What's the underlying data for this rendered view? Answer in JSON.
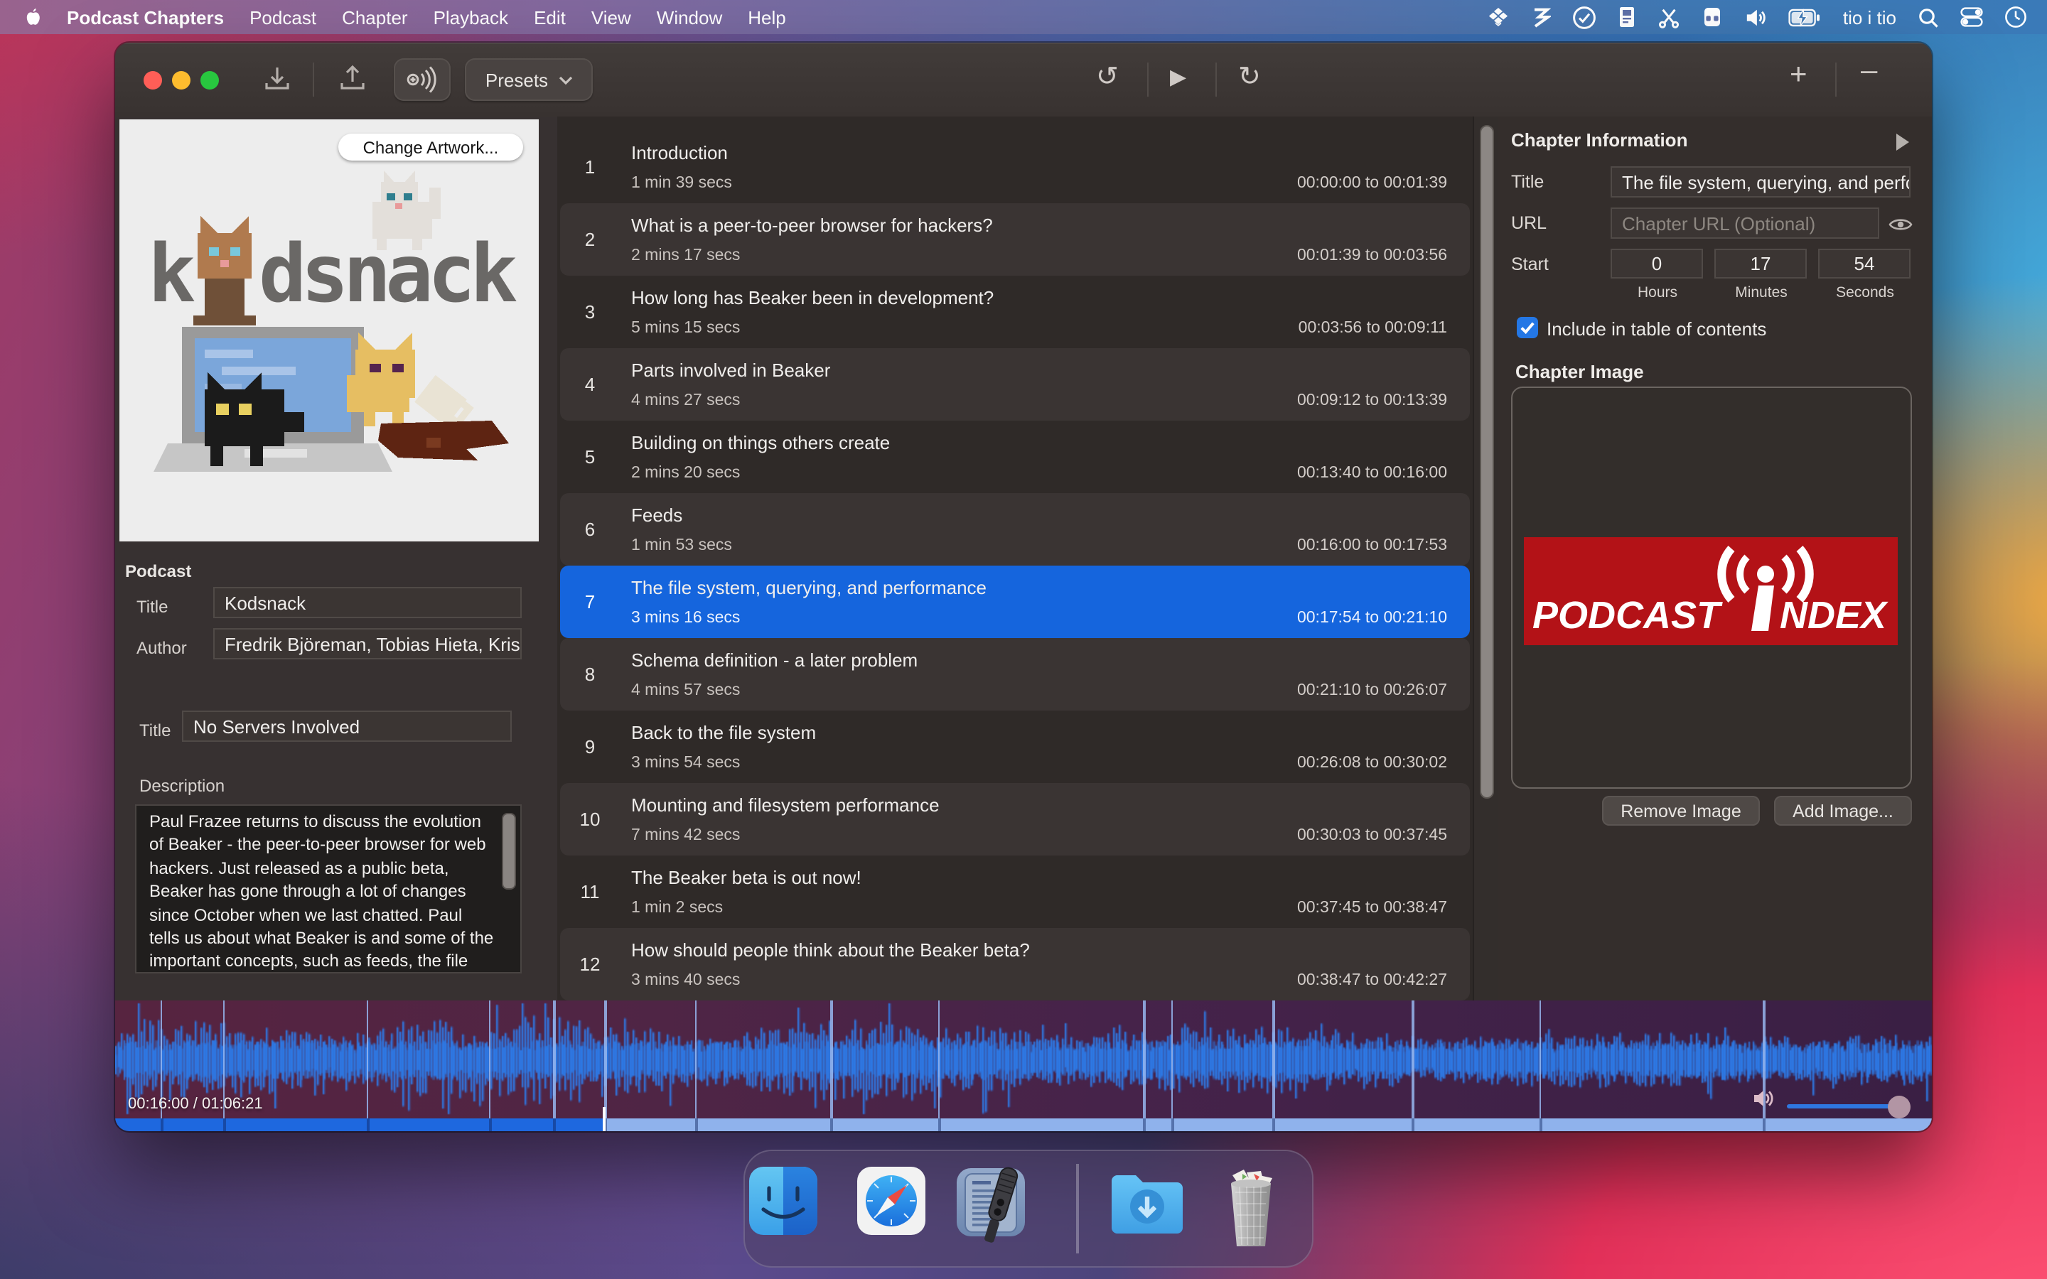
{
  "menu_bar": {
    "app_name": "Podcast Chapters",
    "menus": [
      "Podcast",
      "Chapter",
      "Playback",
      "Edit",
      "View",
      "Window",
      "Help"
    ],
    "status_text": "tio i tio",
    "status_icons": [
      "dropbox-icon",
      "zigzag-icon",
      "check-circle-icon",
      "clipboard-icon",
      "scissors-icon",
      "mask-icon",
      "speaker-icon",
      "battery-charging-icon",
      "spotlight-icon",
      "control-center-icon",
      "clock-icon"
    ]
  },
  "toolbar": {
    "presets_label": "Presets"
  },
  "sidebar": {
    "change_artwork_label": "Change Artwork...",
    "artwork_text": "kodsnack",
    "podcast_section_label": "Podcast",
    "podcast_title_label": "Title",
    "podcast_title": "Kodsnack",
    "podcast_author_label": "Author",
    "podcast_author": "Fredrik Björeman, Tobias Hieta, Kris",
    "episode_title_label": "Title",
    "episode_title": "No Servers Involved",
    "description_label": "Description",
    "description": "Paul Frazee returns to discuss the evolution of Beaker - the peer-to-peer browser for web hackers. Just released as a public beta, Beaker has gone through a lot of changes since October when we last chatted. Paul tells us about what Beaker is and some of the important concepts, such as feeds, the file system, and starting to create things on top of them."
  },
  "chapters": [
    {
      "num": "1",
      "title": "Introduction",
      "duration": "1 min 39 secs",
      "range": "00:00:00 to 00:01:39"
    },
    {
      "num": "2",
      "title": "What is a peer-to-peer browser for hackers?",
      "duration": "2 mins 17 secs",
      "range": "00:01:39 to 00:03:56"
    },
    {
      "num": "3",
      "title": "How long has Beaker been in development?",
      "duration": "5 mins 15 secs",
      "range": "00:03:56 to 00:09:11"
    },
    {
      "num": "4",
      "title": "Parts involved in Beaker",
      "duration": "4 mins 27 secs",
      "range": "00:09:12 to 00:13:39"
    },
    {
      "num": "5",
      "title": "Building on things others create",
      "duration": "2 mins 20 secs",
      "range": "00:13:40 to 00:16:00"
    },
    {
      "num": "6",
      "title": "Feeds",
      "duration": "1 min 53 secs",
      "range": "00:16:00 to 00:17:53"
    },
    {
      "num": "7",
      "title": "The file system, querying, and performance",
      "duration": "3 mins 16 secs",
      "range": "00:17:54 to 00:21:10"
    },
    {
      "num": "8",
      "title": "Schema definition - a later problem",
      "duration": "4 mins 57 secs",
      "range": "00:21:10 to 00:26:07"
    },
    {
      "num": "9",
      "title": "Back to the file system",
      "duration": "3 mins 54 secs",
      "range": "00:26:08 to 00:30:02"
    },
    {
      "num": "10",
      "title": "Mounting and filesystem performance",
      "duration": "7 mins 42 secs",
      "range": "00:30:03 to 00:37:45"
    },
    {
      "num": "11",
      "title": "The Beaker beta is out now!",
      "duration": "1 min 2 secs",
      "range": "00:37:45 to 00:38:47"
    },
    {
      "num": "12",
      "title": "How should people think about the Beaker beta?",
      "duration": "3 mins 40 secs",
      "range": "00:38:47 to 00:42:27"
    }
  ],
  "selected_chapter": "7",
  "chapter_info": {
    "header": "Chapter Information",
    "title_label": "Title",
    "title_value": "The file system, querying, and performance",
    "url_label": "URL",
    "url_placeholder": "Chapter URL (Optional)",
    "start_label": "Start",
    "hours": "0",
    "minutes": "17",
    "seconds": "54",
    "hours_label": "Hours",
    "minutes_label": "Minutes",
    "seconds_label": "Seconds",
    "toc_label": "Include in table of contents",
    "toc_checked": true,
    "image_header": "Chapter Image",
    "image_text_podcast": "PODCAST",
    "image_text_index": "INDEX",
    "remove_image_label": "Remove Image",
    "add_image_label": "Add Image...",
    "accent_red": "#b31217"
  },
  "waveform": {
    "time_label": "00:16:00 / 01:06:21",
    "playhead_fraction": 0.2695,
    "markers": [
      0.0249,
      0.0593,
      0.1384,
      0.2057,
      0.2411,
      0.2695,
      0.319,
      0.3936,
      0.4527,
      0.566,
      0.581,
      0.637,
      0.714,
      0.784,
      0.907
    ],
    "wave_color": "#2e7ae6",
    "played_color": "#1e68df",
    "remaining_color": "#8fb2ec",
    "selection_blue": "#1565dd"
  },
  "dock": {
    "items": [
      "finder",
      "safari",
      "podcast-chapters",
      "downloads",
      "trash"
    ]
  }
}
